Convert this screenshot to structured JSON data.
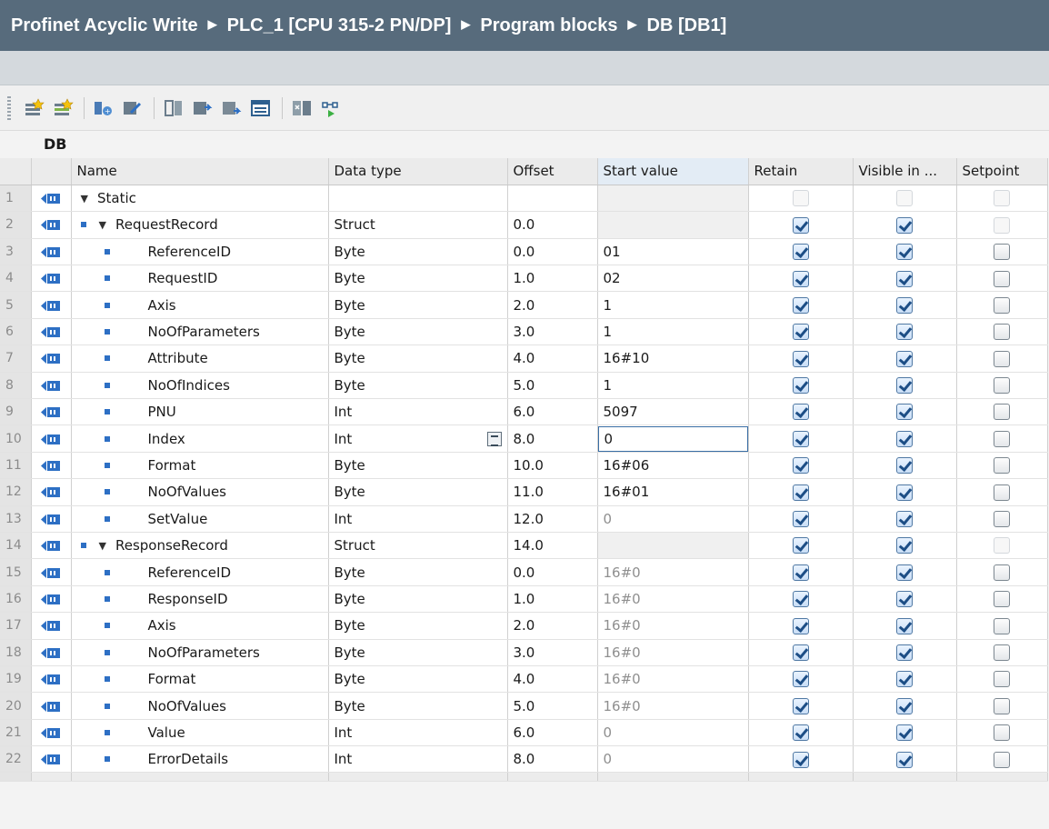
{
  "breadcrumb": [
    "Profinet Acyclic Write",
    "PLC_1 [CPU 315-2 PN/DP]",
    "Program blocks",
    "DB [DB1]"
  ],
  "block_title": "DB",
  "columns": {
    "name": "Name",
    "data_type": "Data type",
    "offset": "Offset",
    "start_value": "Start value",
    "retain": "Retain",
    "visible": "Visible in ...",
    "setpoint": "Setpoint"
  },
  "rows": [
    {
      "n": "1",
      "level": 0,
      "expanded": true,
      "bullet": false,
      "name": "Static",
      "type": "",
      "offset": "",
      "start": "",
      "retain": false,
      "visible": false,
      "setpoint": false
    },
    {
      "n": "2",
      "level": 1,
      "expanded": true,
      "bullet": true,
      "name": "RequestRecord",
      "type": "Struct",
      "offset": "0.0",
      "start": "",
      "retain": true,
      "visible": true,
      "setpoint": false
    },
    {
      "n": "3",
      "level": 2,
      "bullet": true,
      "name": "ReferenceID",
      "type": "Byte",
      "offset": "0.0",
      "start": "01",
      "retain": true,
      "visible": true,
      "setpoint": false
    },
    {
      "n": "4",
      "level": 2,
      "bullet": true,
      "name": "RequestID",
      "type": "Byte",
      "offset": "1.0",
      "start": "02",
      "retain": true,
      "visible": true,
      "setpoint": false
    },
    {
      "n": "5",
      "level": 2,
      "bullet": true,
      "name": "Axis",
      "type": "Byte",
      "offset": "2.0",
      "start": "1",
      "retain": true,
      "visible": true,
      "setpoint": false
    },
    {
      "n": "6",
      "level": 2,
      "bullet": true,
      "name": "NoOfParameters",
      "type": "Byte",
      "offset": "3.0",
      "start": "1",
      "retain": true,
      "visible": true,
      "setpoint": false
    },
    {
      "n": "7",
      "level": 2,
      "bullet": true,
      "name": "Attribute",
      "type": "Byte",
      "offset": "4.0",
      "start": "16#10",
      "retain": true,
      "visible": true,
      "setpoint": false
    },
    {
      "n": "8",
      "level": 2,
      "bullet": true,
      "name": "NoOfIndices",
      "type": "Byte",
      "offset": "5.0",
      "start": "1",
      "retain": true,
      "visible": true,
      "setpoint": false
    },
    {
      "n": "9",
      "level": 2,
      "bullet": true,
      "name": "PNU",
      "type": "Int",
      "offset": "6.0",
      "start": "5097",
      "retain": true,
      "visible": true,
      "setpoint": false
    },
    {
      "n": "10",
      "level": 2,
      "bullet": true,
      "name": "Index",
      "type": "Int",
      "offset": "8.0",
      "start": "0",
      "retain": true,
      "visible": true,
      "setpoint": false,
      "editing": true
    },
    {
      "n": "11",
      "level": 2,
      "bullet": true,
      "name": "Format",
      "type": "Byte",
      "offset": "10.0",
      "start": "16#06",
      "retain": true,
      "visible": true,
      "setpoint": false
    },
    {
      "n": "12",
      "level": 2,
      "bullet": true,
      "name": "NoOfValues",
      "type": "Byte",
      "offset": "11.0",
      "start": "16#01",
      "retain": true,
      "visible": true,
      "setpoint": false
    },
    {
      "n": "13",
      "level": 2,
      "bullet": true,
      "name": "SetValue",
      "type": "Int",
      "offset": "12.0",
      "start": "0",
      "default": true,
      "retain": true,
      "visible": true,
      "setpoint": false
    },
    {
      "n": "14",
      "level": 1,
      "expanded": true,
      "bullet": true,
      "name": "ResponseRecord",
      "type": "Struct",
      "offset": "14.0",
      "start": "",
      "retain": true,
      "visible": true,
      "setpoint": false
    },
    {
      "n": "15",
      "level": 2,
      "bullet": true,
      "name": "ReferenceID",
      "type": "Byte",
      "offset": "0.0",
      "start": "16#0",
      "default": true,
      "retain": true,
      "visible": true,
      "setpoint": false
    },
    {
      "n": "16",
      "level": 2,
      "bullet": true,
      "name": "ResponseID",
      "type": "Byte",
      "offset": "1.0",
      "start": "16#0",
      "default": true,
      "retain": true,
      "visible": true,
      "setpoint": false
    },
    {
      "n": "17",
      "level": 2,
      "bullet": true,
      "name": "Axis",
      "type": "Byte",
      "offset": "2.0",
      "start": "16#0",
      "default": true,
      "retain": true,
      "visible": true,
      "setpoint": false
    },
    {
      "n": "18",
      "level": 2,
      "bullet": true,
      "name": "NoOfParameters",
      "type": "Byte",
      "offset": "3.0",
      "start": "16#0",
      "default": true,
      "retain": true,
      "visible": true,
      "setpoint": false
    },
    {
      "n": "19",
      "level": 2,
      "bullet": true,
      "name": "Format",
      "type": "Byte",
      "offset": "4.0",
      "start": "16#0",
      "default": true,
      "retain": true,
      "visible": true,
      "setpoint": false
    },
    {
      "n": "20",
      "level": 2,
      "bullet": true,
      "name": "NoOfValues",
      "type": "Byte",
      "offset": "5.0",
      "start": "16#0",
      "default": true,
      "retain": true,
      "visible": true,
      "setpoint": false
    },
    {
      "n": "21",
      "level": 2,
      "bullet": true,
      "name": "Value",
      "type": "Int",
      "offset": "6.0",
      "start": "0",
      "default": true,
      "retain": true,
      "visible": true,
      "setpoint": false
    },
    {
      "n": "22",
      "level": 2,
      "bullet": true,
      "name": "ErrorDetails",
      "type": "Int",
      "offset": "8.0",
      "start": "0",
      "default": true,
      "retain": true,
      "visible": true,
      "setpoint": false
    }
  ],
  "toolbar_icons": [
    "insert-row-icon",
    "add-row-icon",
    "expand-all-icon",
    "collapse-all-icon",
    "snapshot-icon",
    "copy-snapshot-icon",
    "copy-start-values-icon",
    "load-start-values-icon",
    "keep-actual-values-icon",
    "monitor-all-icon"
  ],
  "colors": {
    "title_bg": "#576b7c",
    "subbar_bg": "#d4d9dd",
    "accent": "#2d6fc4"
  }
}
